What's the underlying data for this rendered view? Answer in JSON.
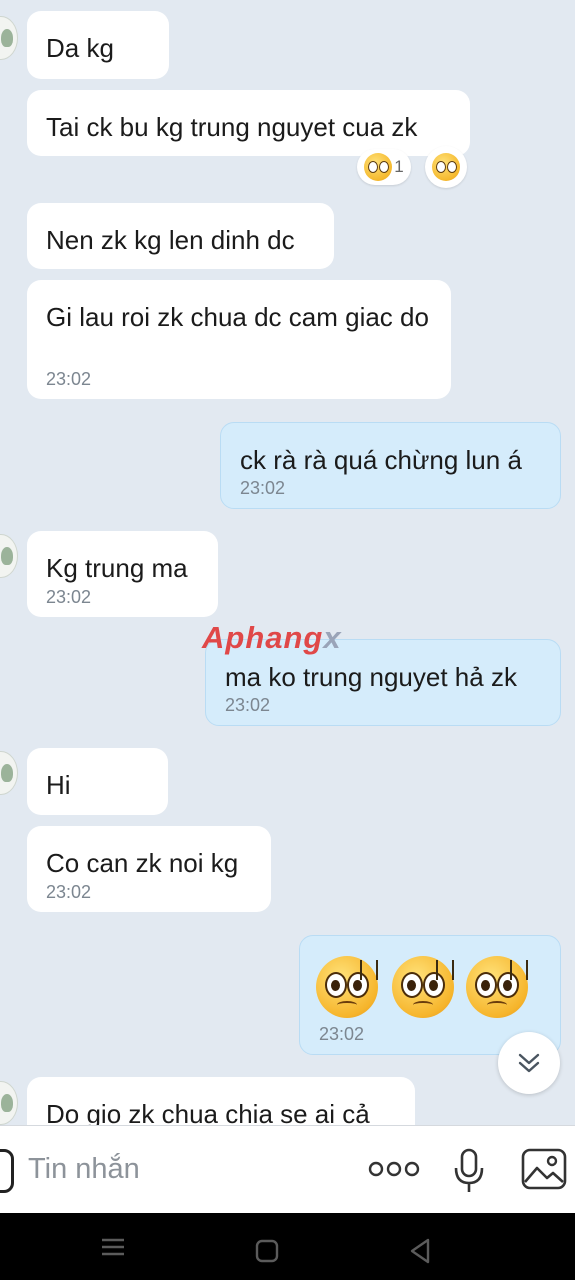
{
  "messages": {
    "m1": {
      "text": "Da kg"
    },
    "m2": {
      "text": "Tai ck bu kg trung nguyet cua zk",
      "reaction_count": "1"
    },
    "m3": {
      "text": "Nen zk kg len dinh dc"
    },
    "m4": {
      "text": "Gi lau roi zk chua dc cam giac do",
      "time": "23:02"
    },
    "m5": {
      "text": "ck rà rà quá chừng lun á",
      "time": "23:02"
    },
    "m6": {
      "text": "Kg trung ma",
      "time": "23:02"
    },
    "m7": {
      "text": "ma ko trung nguyet hả zk",
      "time": "23:02"
    },
    "m8": {
      "text": "Hi"
    },
    "m9": {
      "text": "Co can zk noi kg",
      "time": "23:02"
    },
    "m10": {
      "time": "23:02",
      "emoji": "sweating-pleading-face x3"
    },
    "m11": {
      "text": "Do gio zk chua chia se ai cả"
    }
  },
  "watermark": {
    "main": "Aphang",
    "x": "x"
  },
  "input": {
    "placeholder": "Tin nhắn"
  },
  "icons": [
    "more-dots-icon",
    "microphone-icon",
    "image-icon",
    "scroll-down-icon",
    "menu-icon",
    "home-icon",
    "back-icon"
  ],
  "colors": {
    "background": "#e2e9f1",
    "incoming": "#ffffff",
    "outgoing": "#d5ecfb",
    "timestamp": "#7c8690"
  }
}
